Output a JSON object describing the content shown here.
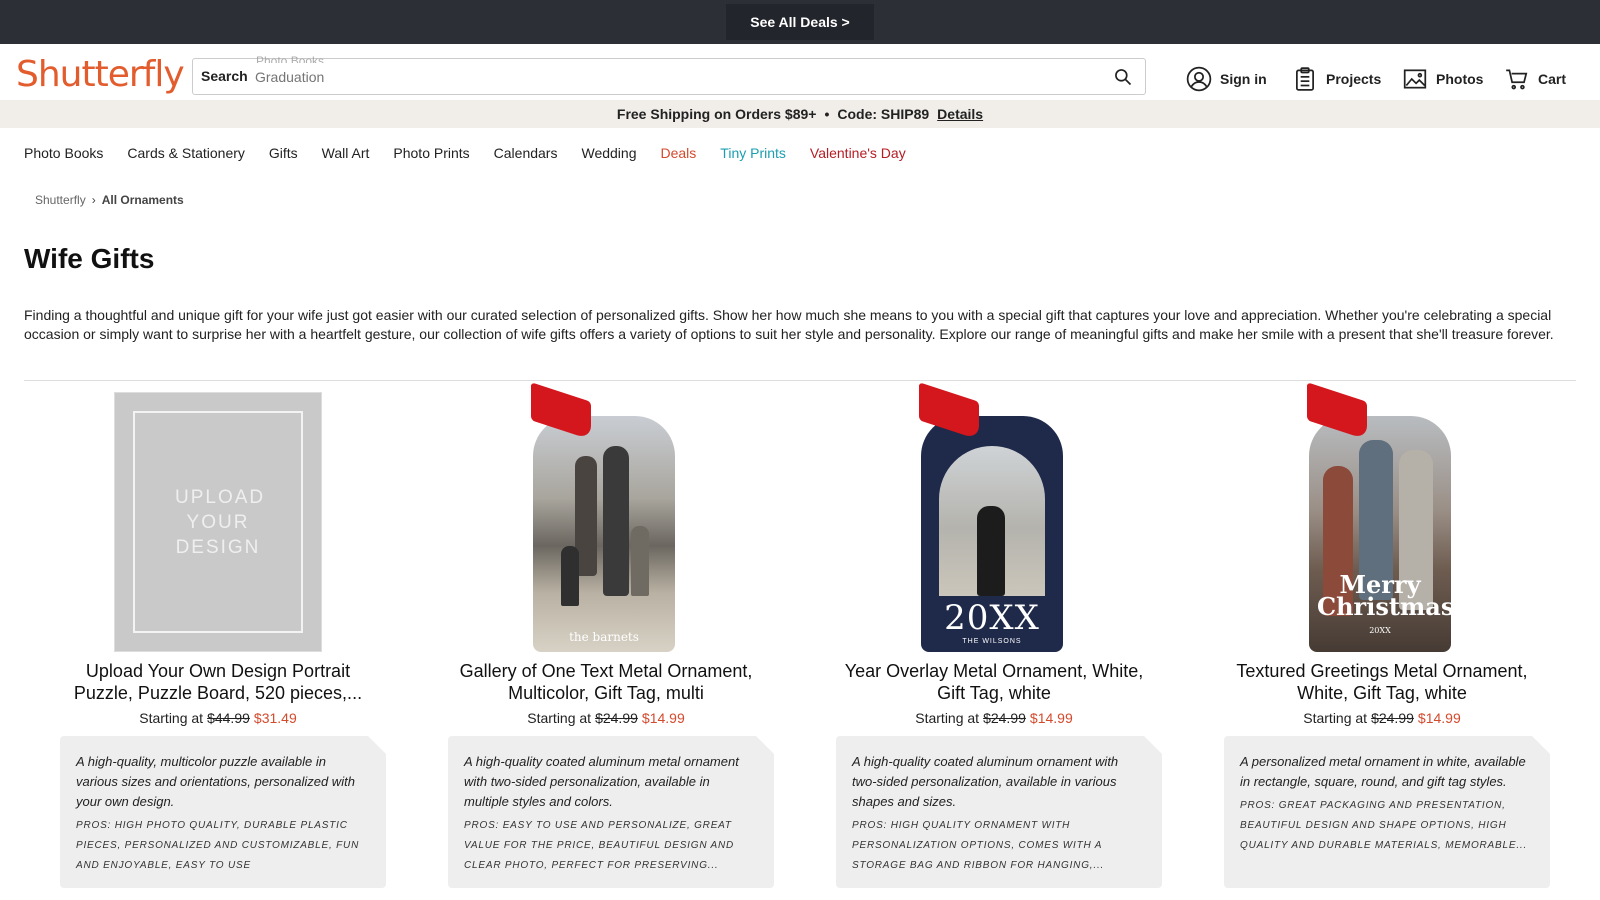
{
  "promo": {
    "button_label": "See All Deals >"
  },
  "header": {
    "logo": "Shutterfly",
    "search_label": "Search",
    "search_hint_faded": "Photo Books",
    "search_placeholder": "Graduation",
    "utility": {
      "sign_in": "Sign in",
      "projects": "Projects",
      "photos": "Photos",
      "cart": "Cart"
    }
  },
  "shipping": {
    "text": "Free Shipping on Orders $89+",
    "separator": "•",
    "code": "Code: SHIP89",
    "details_link": "Details"
  },
  "nav": {
    "items": [
      "Photo Books",
      "Cards & Stationery",
      "Gifts",
      "Wall Art",
      "Photo Prints",
      "Calendars",
      "Wedding",
      "Deals",
      "Tiny Prints",
      "Valentine's Day"
    ]
  },
  "breadcrumb": {
    "home": "Shutterfly",
    "chevron": "›",
    "current": "All Ornaments"
  },
  "page": {
    "title": "Wife Gifts",
    "description": "Finding a thoughtful and unique gift for your wife just got easier with our curated selection of personalized gifts. Show her how much she means to you with a special gift that captures your love and appreciation. Whether you're celebrating a special occasion or simply want to surprise her with a heartfelt gesture, our collection of wife gifts offers a variety of options to suit her style and personality. Explore our range of meaningful gifts and make her smile with a present that she'll treasure forever."
  },
  "products": [
    {
      "title_line1": "Upload Your Own Design Portrait",
      "title_line2": "Puzzle, Puzzle Board, 520 pieces,...",
      "starting_at": "Starting at",
      "price_old": "$44.99",
      "price_new": "$31.49",
      "image_text": "UPLOAD YOUR DESIGN",
      "description": "A high-quality, multicolor puzzle available in various sizes and orientations, personalized with your own design.",
      "pros": "Pros: High photo quality, durable plastic pieces, personalized and customizable, fun and enjoyable, easy to use"
    },
    {
      "title_line1": "Gallery of One Text Metal Ornament,",
      "title_line2": "Multicolor, Gift Tag, multi",
      "starting_at": "Starting at",
      "price_old": "$24.99",
      "price_new": "$14.99",
      "image_text": "the barnets",
      "description": "A high-quality coated aluminum metal ornament with two-sided personalization, available in multiple styles and colors.",
      "pros": "Pros: Easy to use and personalize, great value for the price, beautiful design and clear photo, perfect for preserving..."
    },
    {
      "title_line1": "Year Overlay Metal Ornament, White,",
      "title_line2": "Gift Tag, white",
      "starting_at": "Starting at",
      "price_old": "$24.99",
      "price_new": "$14.99",
      "image_text": "20XX",
      "image_subtext": "THE WILSONS",
      "description": "A high-quality coated aluminum ornament with two-sided personalization, available in various shapes and sizes.",
      "pros": "Pros: High quality ornament with personalization options, comes with a storage bag and ribbon for hanging,..."
    },
    {
      "title_line1": "Textured Greetings Metal Ornament,",
      "title_line2": "White, Gift Tag, white",
      "starting_at": "Starting at",
      "price_old": "$24.99",
      "price_new": "$14.99",
      "image_text": "Merry Christmas",
      "image_subtext": "20XX",
      "description": "A personalized metal ornament in white, available in rectangle, square, round, and gift tag styles.",
      "pros": "Pros: Great packaging and presentation, beautiful design and shape options, high quality and durable materials, memorable..."
    }
  ],
  "colors": {
    "brand": "#e25c2e",
    "sale": "#d44a2d",
    "tiny_prints": "#1a9fb0",
    "valentine": "#b51d24",
    "promo_bar": "#2c2f36"
  }
}
